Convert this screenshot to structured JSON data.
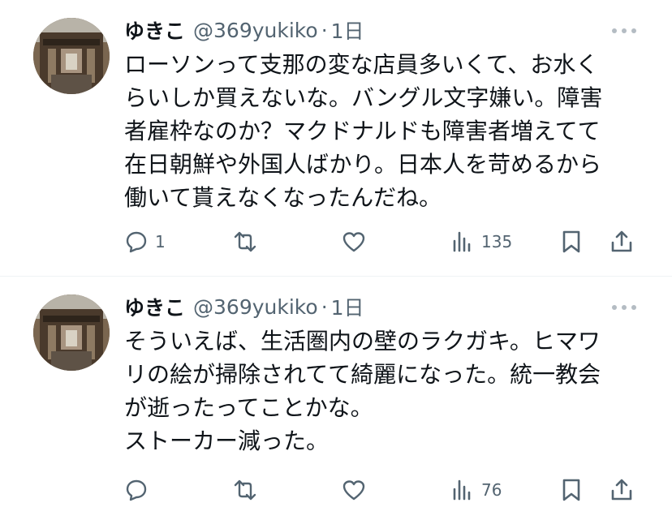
{
  "tweets": [
    {
      "author_name": "ゆきこ",
      "handle": "@369yukiko",
      "separator": "·",
      "time": "1日",
      "lines": [
        "ローソンって支那の変な店員多いくて、お水く",
        "らいしか買えないな。バングル文字嫌い。障害",
        "者雇枠なのか？マクドナルドも障害者増えてて",
        "在日朝鮮や外国人ばかり。日本人を苛めるから",
        "働いて貰えなくなったんだね。"
      ],
      "reply_count": "1",
      "retweet_count": "",
      "like_count": "",
      "view_count": "135"
    },
    {
      "author_name": "ゆきこ",
      "handle": "@369yukiko",
      "separator": "·",
      "time": "1日",
      "lines": [
        "そういえば、生活圏内の壁のラクガキ。ヒマワ",
        "リの絵が掃除されてて綺麗になった。統一教会",
        "が逝ったってことかな。",
        "ストーカー減った。"
      ],
      "reply_count": "",
      "retweet_count": "",
      "like_count": "",
      "view_count": "76"
    }
  ],
  "icons": {
    "reply": "reply-bubble-icon",
    "retweet": "retweet-arrows-icon",
    "like": "heart-icon",
    "views": "bar-chart-icon",
    "bookmark": "bookmark-icon",
    "share": "share-upload-icon",
    "more": "more-dots-icon"
  },
  "colors": {
    "text": "#0f1419",
    "secondary": "#536471",
    "divider": "#eff3f4"
  }
}
